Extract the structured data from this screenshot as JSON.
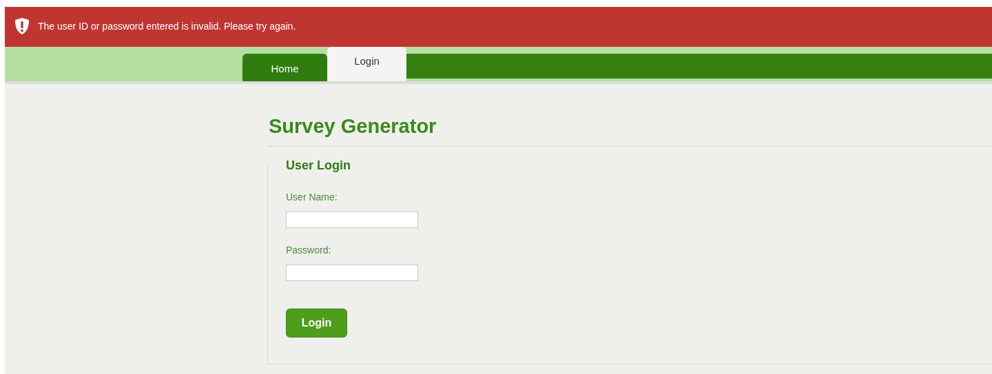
{
  "alert": {
    "message": "The user ID or password entered is invalid. Please try again."
  },
  "tabs": [
    {
      "label": "Home",
      "selected": false
    },
    {
      "label": "Login",
      "selected": true
    }
  ],
  "title": "Survey Generator",
  "form": {
    "legend": "User Login",
    "fields": [
      {
        "label": "User Name:"
      },
      {
        "label": "Password:"
      }
    ],
    "button": "Login"
  }
}
